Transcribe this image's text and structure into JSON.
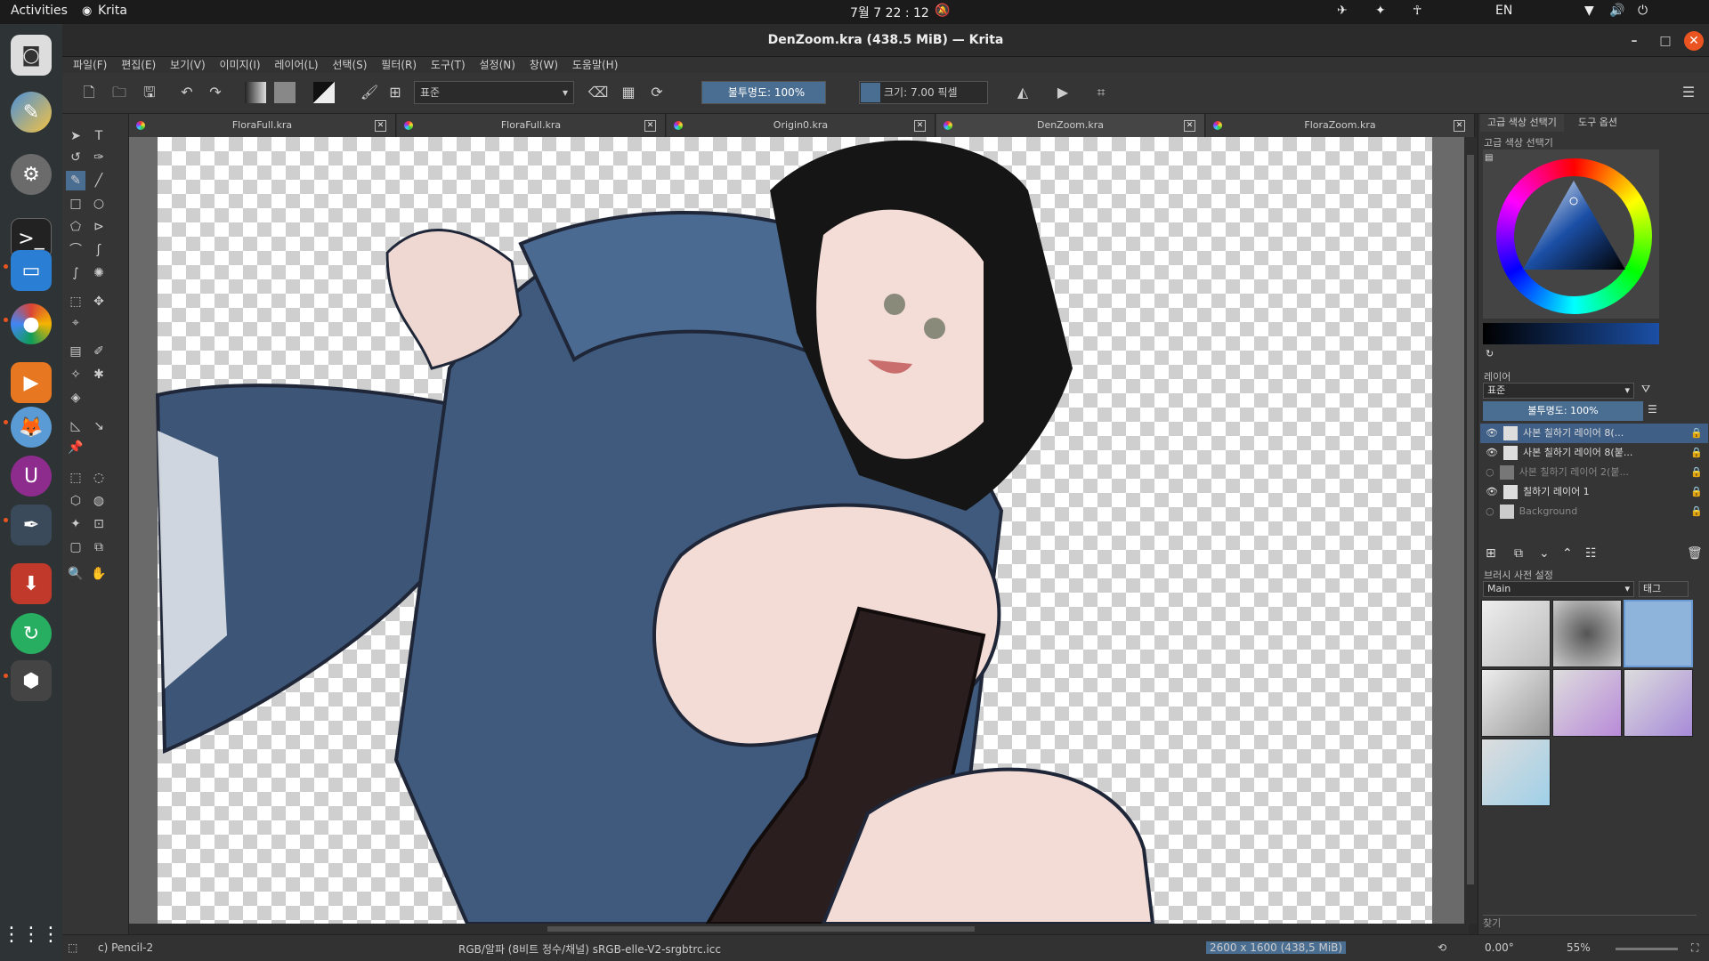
{
  "topbar": {
    "activities": "Activities",
    "app_name": "Krita",
    "clock": "7월 7  22 : 12",
    "lang": "EN"
  },
  "window": {
    "title": "DenZoom.kra (438.5 MiB) — Krita"
  },
  "menu": [
    "파일(F)",
    "편집(E)",
    "보기(V)",
    "이미지(I)",
    "레이어(L)",
    "선택(S)",
    "필터(R)",
    "도구(T)",
    "설정(N)",
    "창(W)",
    "도움말(H)"
  ],
  "toolbar": {
    "blend_mode": "표준",
    "opacity": "불투명도: 100%",
    "size": "크기: 7.00 픽셀"
  },
  "tabs": [
    {
      "label": "FloraFull.kra",
      "active": false
    },
    {
      "label": "FloraFull.kra",
      "active": false
    },
    {
      "label": "Origin0.kra",
      "active": false
    },
    {
      "label": "DenZoom.kra",
      "active": true
    },
    {
      "label": "FloraZoom.kra",
      "active": false
    }
  ],
  "panels": {
    "tabs": [
      "고급 색상 선택기",
      "도구 옵션"
    ],
    "color_title": "고급 색상 선택기",
    "layers_title": "레이어",
    "layer_blend": "표준",
    "layer_opacity": "불투명도: 100%",
    "layers": [
      {
        "name": "사본 칠하기 레이어 8(...",
        "visible": true,
        "selected": true
      },
      {
        "name": "사본 칠하기 레이어 8(붙...",
        "visible": true,
        "selected": false
      },
      {
        "name": "사본 칠하기 레이어 2(붙...",
        "visible": false,
        "selected": false
      },
      {
        "name": "칠하기 레이어 1",
        "visible": true,
        "selected": false
      },
      {
        "name": "Background",
        "visible": false,
        "selected": false
      }
    ],
    "brush_title": "브러시 사전 설정",
    "brush_group": "Main",
    "brush_tag": "태그",
    "search_label": "찾기"
  },
  "status": {
    "brush": "c) Pencil-2",
    "color": "RGB/알파 (8비트 정수/채널)  sRGB-elle-V2-srgbtrc.icc",
    "dimensions": "2600 x 1600 (438,5 MiB)",
    "rotation": "0.00°",
    "zoom": "55%"
  }
}
